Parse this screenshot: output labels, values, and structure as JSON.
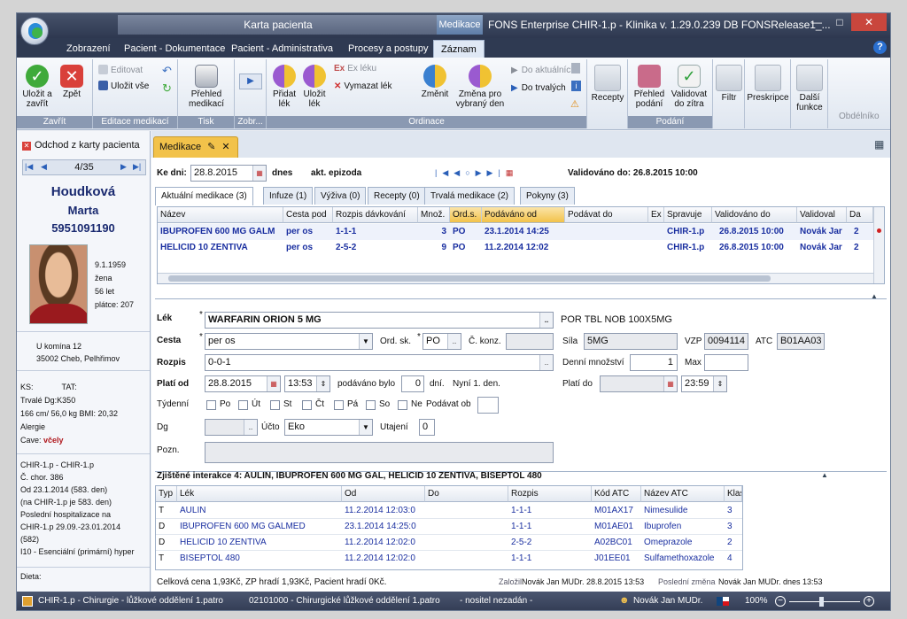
{
  "window": {
    "context_tab_karta": "Karta pacienta",
    "context_tab_medikace": "Medikace",
    "title": "FONS Enterprise CHIR-1.p - Klinika v. 1.29.0.239 DB FONSRelease1_..."
  },
  "ribbon_tabs": [
    "Zobrazení",
    "Pacient - Dokumentace",
    "Pacient - Administrativa",
    "Procesy a postupy",
    "Záznam"
  ],
  "ribbon": {
    "zavrit": {
      "label": "Zavřít",
      "ulozit_zavrit": "Uložit a zavřít",
      "zpet": "Zpět"
    },
    "editace": {
      "label": "Editace medikací",
      "editovat": "Editovat",
      "ulozit_vse": "Uložit vše"
    },
    "tisk": {
      "label": "Tisk",
      "prehled": "Přehled medikací"
    },
    "zobr": {
      "label": "Zobr..."
    },
    "ordinace": {
      "label": "Ordinace",
      "pridat": "Přidat lék",
      "ulozit": "Uložit lék",
      "ex_leku": "Ex léku",
      "vymazat": "Vymazat lék",
      "zmenit": "Změnit",
      "zmena": "Změna pro vybraný den",
      "do_aktualnich": "Do aktuálních",
      "do_trvalych": "Do trvalých"
    },
    "podani": {
      "label": "Podání",
      "recepty": "Recepty",
      "prehled_podani": "Přehled podání",
      "validovat": "Validovat do zítra"
    },
    "filtr": "Filtr",
    "preskripce": "Preskripce",
    "dalsi": "Další funkce",
    "obdelnikove": "Obdélníko"
  },
  "sidebar": {
    "odchod": "Odchod z karty pacienta",
    "pager": "4/35",
    "surname": "Houdková",
    "firstname": "Marta",
    "rc": "5951091190",
    "birth": "9.1.1959",
    "sex": "žena",
    "age": "56 let",
    "payer": "plátce: 207",
    "address1": "U komína 12",
    "address2": "35002 Cheb, Pelhřimov",
    "ks": "KS:",
    "tat": "TAT:",
    "trvale_dg": "Trvalé Dg:K350",
    "bmi": "166 cm/ 56,0 kg BMI: 20,32",
    "alergie": "Alergie",
    "cave_label": "Cave:",
    "cave_value": "včely",
    "info": [
      "CHIR-1.p - CHIR-1.p",
      "Č. chor.  386",
      "Od 23.1.2014 (583. den)",
      "(na CHIR-1.p je 583. den)",
      "Poslední hospitalizace na",
      "CHIR-1.p 29.09.-23.01.2014",
      "(582)",
      "I10 - Esenciální (primární) hyper"
    ],
    "dieta": "Dieta:"
  },
  "doc_tab": {
    "label": "Medikace"
  },
  "header": {
    "ke_dni": "Ke dni:",
    "date": "28.8.2015",
    "dnes": "dnes",
    "epizoda": "akt. epizoda",
    "validovano": "Validováno do: 26.8.2015 10:00"
  },
  "inner_tabs": [
    "Aktuální medikace (3)",
    "Infuze (1)",
    "Výživa (0)",
    "Recepty (0)",
    "Trvalá medikace (2)",
    "Pokyny (3)"
  ],
  "top_grid": {
    "columns": [
      "Název",
      "Cesta pod",
      "Rozpis dávkování",
      "Množ.",
      "Ord.s.",
      "Podáváno od",
      "Podávat do",
      "Ex",
      "Spravuje",
      "Validováno do",
      "Validoval",
      "Da"
    ],
    "rows": [
      [
        "IBUPROFEN 600 MG GALM",
        "per os",
        "1-1-1",
        "3",
        "PO",
        "23.1.2014 14:25",
        "",
        "",
        "CHIR-1.p",
        "26.8.2015 10:00",
        "Novák Jar",
        "2"
      ],
      [
        "HELICID 10 ZENTIVA",
        "per os",
        "2-5-2",
        "9",
        "PO",
        "11.2.2014 12:02",
        "",
        "",
        "CHIR-1.p",
        "26.8.2015 10:00",
        "Novák Jar",
        "2"
      ]
    ]
  },
  "form": {
    "lek_label": "Lék",
    "lek": "WARFARIN ORION 5 MG",
    "lek_desc": "POR TBL NOB 100X5MG",
    "cesta_label": "Cesta",
    "cesta": "per os",
    "ordsk_label": "Ord. sk.",
    "ordsk": "PO",
    "ckonz_label": "Č. konz.",
    "sila_label": "Síla",
    "sila": "5MG",
    "vzp_label": "VZP",
    "vzp": "0094114",
    "atc_label": "ATC",
    "atc": "B01AA03",
    "rozpis_label": "Rozpis",
    "rozpis": "0-0-1",
    "denni_label": "Denní množství",
    "denni": "1",
    "max_label": "Max",
    "plati_od_label": "Platí od",
    "plati_od": "28.8.2015",
    "plati_cas": "13:53",
    "podavano_label": "podáváno bylo",
    "podavano": "0",
    "dni_label": "dní.",
    "nyni": "Nyní 1. den.",
    "plati_do_label": "Platí do",
    "plati_do_cas": "23:59",
    "tydenni_label": "Týdenní",
    "days": [
      "Po",
      "Út",
      "St",
      "Čt",
      "Pá",
      "So",
      "Ne"
    ],
    "podavat_ob": "Podávat ob",
    "dg_label": "Dg",
    "ucto_label": "Účto",
    "ucto": "Eko",
    "utajeni_label": "Utajení",
    "utajeni": "0",
    "pozn_label": "Pozn."
  },
  "interactions": {
    "title": "Zjištěné interakce 4: AULIN, IBUPROFEN 600 MG GAL, HELICID 10 ZENTIVA, BISEPTOL 480",
    "columns": [
      "Typ",
      "Lék",
      "Od",
      "Do",
      "Rozpis",
      "Kód ATC",
      "Název ATC",
      "Klas"
    ],
    "rows": [
      [
        "T",
        "AULIN",
        "11.2.2014 12:03:0",
        "",
        "1-1-1",
        "M01AX17",
        "Nimesulide",
        "3"
      ],
      [
        "D",
        "IBUPROFEN 600 MG GALMED",
        "23.1.2014 14:25:0",
        "",
        "1-1-1",
        "M01AE01",
        "Ibuprofen",
        "3"
      ],
      [
        "D",
        "HELICID 10 ZENTIVA",
        "11.2.2014 12:02:0",
        "",
        "2-5-2",
        "A02BC01",
        "Omeprazole",
        "2"
      ],
      [
        "T",
        "BISEPTOL 480",
        "11.2.2014 12:02:0",
        "",
        "1-1-1",
        "J01EE01",
        "Sulfamethoxazole",
        "4"
      ]
    ]
  },
  "footer": {
    "cena": "Celková cena 1,93Kč, ZP hradí 1,93Kč, Pacient hradí 0Kč.",
    "zalozil_label": "Založil",
    "zalozil": "Novák Jan MUDr. 28.8.2015 13:53",
    "posledni_label": "Poslední změna",
    "posledni": "Novák Jan MUDr.  dnes   13:53"
  },
  "statusbar": {
    "dept": "CHIR-1.p - Chirurgie - lůžkové oddělení 1.patro",
    "code": "02101000 - Chirurgické lůžkové oddělení 1.patro",
    "nurse": "- nositel nezadán -",
    "user": "Novák Jan MUDr.",
    "zoom": "100%"
  },
  "colors": {
    "accent": "#f2c24a",
    "link_blue": "#1a2fa0",
    "chrome_dark": "#2f3a52"
  }
}
